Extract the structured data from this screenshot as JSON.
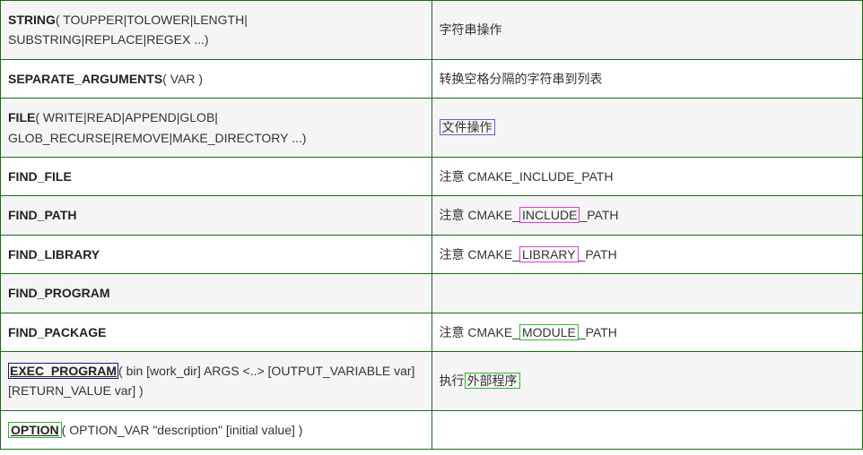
{
  "rows": [
    {
      "cmd_bold": "STRING",
      "cmd_args": "( TOUPPER|TOLOWER|LENGTH| SUBSTRING|REPLACE|REGEX ...)",
      "desc_plain": "字符串操作"
    },
    {
      "cmd_bold": "SEPARATE_ARGUMENTS",
      "cmd_args": "( VAR )",
      "desc_plain": "转换空格分隔的字符串到列表"
    },
    {
      "cmd_bold": "FILE",
      "cmd_args": "( WRITE|READ|APPEND|GLOB| GLOB_RECURSE|REMOVE|MAKE_DIRECTORY ...)",
      "desc_link": "文件操作"
    },
    {
      "cmd_bold": "FIND_FILE",
      "cmd_args": "",
      "desc_plain": "注意 CMAKE_INCLUDE_PATH"
    },
    {
      "cmd_bold": "FIND_PATH",
      "cmd_args": "",
      "desc_prefix": "注意 CMAKE_",
      "desc_boxed": "INCLUDE",
      "desc_box_class": "box-magenta",
      "desc_suffix": "_PATH"
    },
    {
      "cmd_bold": "FIND_LIBRARY",
      "cmd_args": "",
      "desc_prefix": "注意 CMAKE_",
      "desc_boxed": "LIBRARY",
      "desc_box_class": "box-magenta",
      "desc_suffix": "_PATH"
    },
    {
      "cmd_bold": "FIND_PROGRAM",
      "cmd_args": "",
      "desc_plain": ""
    },
    {
      "cmd_bold": "FIND_PACKAGE",
      "cmd_args": "",
      "desc_prefix": "注意 CMAKE_",
      "desc_boxed": "MODULE",
      "desc_box_class": "box-green",
      "desc_suffix": "_PATH"
    },
    {
      "cmd_link_bold": "EXEC_PROGRAM",
      "cmd_args": "( bin [work_dir] ARGS <..> [OUTPUT_VARIABLE var] [RETURN_VALUE var] )",
      "desc_prefix": "执行",
      "desc_boxed": "外部程序",
      "desc_box_class": "box-green",
      "desc_suffix": ""
    },
    {
      "cmd_link_green": "OPTION",
      "cmd_args": "( OPTION_VAR \"description\" [initial value] )",
      "desc_plain": ""
    }
  ]
}
